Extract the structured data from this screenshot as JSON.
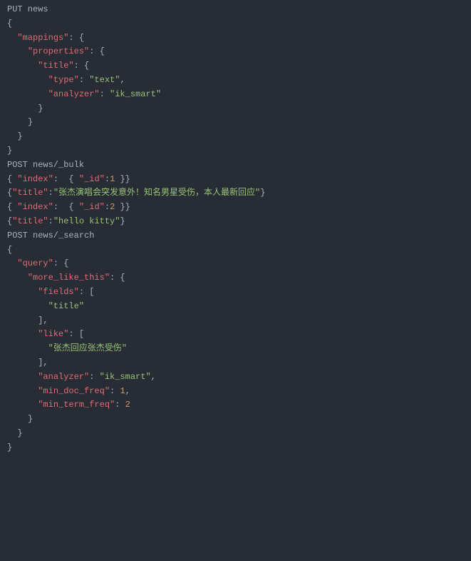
{
  "lines": [
    {
      "indent": 0,
      "parts": [
        {
          "cls": "text",
          "t": "PUT news"
        }
      ]
    },
    {
      "indent": 0,
      "parts": [
        {
          "cls": "punc",
          "t": "{"
        }
      ]
    },
    {
      "indent": 1,
      "parts": [
        {
          "cls": "key",
          "t": "\"mappings\""
        },
        {
          "cls": "punc",
          "t": ": {"
        }
      ]
    },
    {
      "indent": 2,
      "parts": [
        {
          "cls": "key",
          "t": "\"properties\""
        },
        {
          "cls": "punc",
          "t": ": {"
        }
      ]
    },
    {
      "indent": 3,
      "parts": [
        {
          "cls": "key",
          "t": "\"title\""
        },
        {
          "cls": "punc",
          "t": ": {"
        }
      ]
    },
    {
      "indent": 4,
      "parts": [
        {
          "cls": "key",
          "t": "\"type\""
        },
        {
          "cls": "punc",
          "t": ": "
        },
        {
          "cls": "str",
          "t": "\"text\""
        },
        {
          "cls": "punc",
          "t": ","
        }
      ]
    },
    {
      "indent": 4,
      "parts": [
        {
          "cls": "key",
          "t": "\"analyzer\""
        },
        {
          "cls": "punc",
          "t": ": "
        },
        {
          "cls": "str",
          "t": "\"ik_smart\""
        }
      ]
    },
    {
      "indent": 3,
      "parts": [
        {
          "cls": "punc",
          "t": "}"
        }
      ]
    },
    {
      "indent": 2,
      "parts": [
        {
          "cls": "punc",
          "t": "}"
        }
      ]
    },
    {
      "indent": 1,
      "parts": [
        {
          "cls": "punc",
          "t": "}"
        }
      ]
    },
    {
      "indent": 0,
      "parts": [
        {
          "cls": "punc",
          "t": "}"
        }
      ]
    },
    {
      "indent": 0,
      "parts": [
        {
          "cls": "text",
          "t": "POST news/_bulk"
        }
      ]
    },
    {
      "indent": 0,
      "parts": [
        {
          "cls": "punc",
          "t": "{ "
        },
        {
          "cls": "key",
          "t": "\"index\""
        },
        {
          "cls": "punc",
          "t": ":  { "
        },
        {
          "cls": "key",
          "t": "\"_id\""
        },
        {
          "cls": "punc",
          "t": ":"
        },
        {
          "cls": "num",
          "t": "1"
        },
        {
          "cls": "punc",
          "t": " }}"
        }
      ]
    },
    {
      "indent": 0,
      "parts": [
        {
          "cls": "punc",
          "t": "{"
        },
        {
          "cls": "key",
          "t": "\"title\""
        },
        {
          "cls": "punc",
          "t": ":"
        },
        {
          "cls": "str",
          "t": "\"张杰演唱会突发意外！知名男星受伤，本人最新回应\""
        },
        {
          "cls": "punc",
          "t": "}"
        }
      ]
    },
    {
      "indent": 0,
      "parts": [
        {
          "cls": "punc",
          "t": "{ "
        },
        {
          "cls": "key",
          "t": "\"index\""
        },
        {
          "cls": "punc",
          "t": ":  { "
        },
        {
          "cls": "key",
          "t": "\"_id\""
        },
        {
          "cls": "punc",
          "t": ":"
        },
        {
          "cls": "num",
          "t": "2"
        },
        {
          "cls": "punc",
          "t": " }}"
        }
      ]
    },
    {
      "indent": 0,
      "parts": [
        {
          "cls": "punc",
          "t": "{"
        },
        {
          "cls": "key",
          "t": "\"title\""
        },
        {
          "cls": "punc",
          "t": ":"
        },
        {
          "cls": "str",
          "t": "\"hello kitty\""
        },
        {
          "cls": "punc",
          "t": "}"
        }
      ]
    },
    {
      "indent": 0,
      "parts": [
        {
          "cls": "text",
          "t": ""
        }
      ]
    },
    {
      "indent": 0,
      "parts": [
        {
          "cls": "text",
          "t": "POST news/_search"
        }
      ]
    },
    {
      "indent": 0,
      "parts": [
        {
          "cls": "punc",
          "t": "{"
        }
      ]
    },
    {
      "indent": 1,
      "parts": [
        {
          "cls": "key",
          "t": "\"query\""
        },
        {
          "cls": "punc",
          "t": ": {"
        }
      ]
    },
    {
      "indent": 2,
      "parts": [
        {
          "cls": "key",
          "t": "\"more_like_this\""
        },
        {
          "cls": "punc",
          "t": ": {"
        }
      ]
    },
    {
      "indent": 3,
      "parts": [
        {
          "cls": "key",
          "t": "\"fields\""
        },
        {
          "cls": "punc",
          "t": ": ["
        }
      ]
    },
    {
      "indent": 4,
      "parts": [
        {
          "cls": "str",
          "t": "\"title\""
        }
      ]
    },
    {
      "indent": 3,
      "parts": [
        {
          "cls": "punc",
          "t": "],"
        }
      ]
    },
    {
      "indent": 3,
      "parts": [
        {
          "cls": "key",
          "t": "\"like\""
        },
        {
          "cls": "punc",
          "t": ": ["
        }
      ]
    },
    {
      "indent": 4,
      "parts": [
        {
          "cls": "str",
          "t": "\"张杰回应张杰受伤\""
        }
      ]
    },
    {
      "indent": 3,
      "parts": [
        {
          "cls": "punc",
          "t": "],"
        }
      ]
    },
    {
      "indent": 3,
      "parts": [
        {
          "cls": "key",
          "t": "\"analyzer\""
        },
        {
          "cls": "punc",
          "t": ": "
        },
        {
          "cls": "str",
          "t": "\"ik_smart\""
        },
        {
          "cls": "punc",
          "t": ","
        }
      ]
    },
    {
      "indent": 3,
      "parts": [
        {
          "cls": "key",
          "t": "\"min_doc_freq\""
        },
        {
          "cls": "punc",
          "t": ": "
        },
        {
          "cls": "num",
          "t": "1"
        },
        {
          "cls": "punc",
          "t": ","
        }
      ]
    },
    {
      "indent": 3,
      "parts": [
        {
          "cls": "key",
          "t": "\"min_term_freq\""
        },
        {
          "cls": "punc",
          "t": ": "
        },
        {
          "cls": "num",
          "t": "2"
        }
      ]
    },
    {
      "indent": 2,
      "parts": [
        {
          "cls": "punc",
          "t": "}"
        }
      ]
    },
    {
      "indent": 1,
      "parts": [
        {
          "cls": "punc",
          "t": "}"
        }
      ]
    },
    {
      "indent": 0,
      "parts": [
        {
          "cls": "punc",
          "t": "}"
        }
      ]
    }
  ]
}
